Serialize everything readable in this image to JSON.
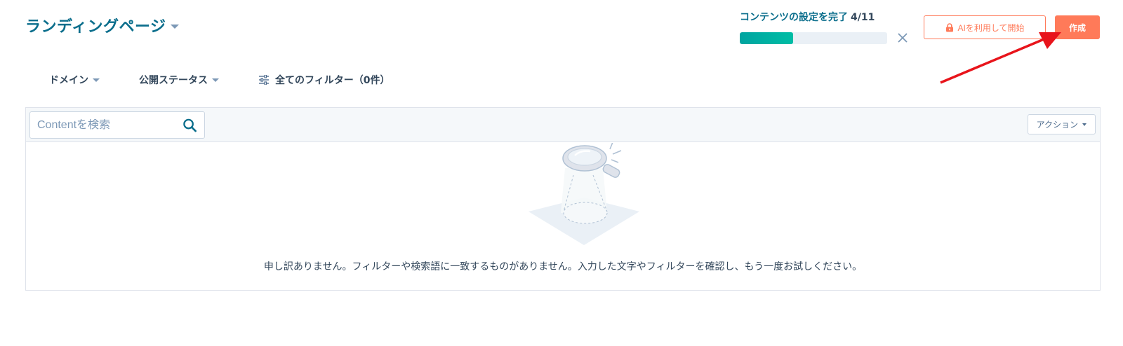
{
  "header": {
    "title": "ランディングページ"
  },
  "progress": {
    "label": "コンテンツの設定を完了",
    "count": "4/11",
    "fraction": 0.36
  },
  "buttons": {
    "ai_label": "AIを利用して開始",
    "create_label": "作成",
    "actions_label": "アクション"
  },
  "filters": {
    "domain": "ドメイン",
    "status": "公開ステータス",
    "all_filters": "全てのフィルター（0件）"
  },
  "search": {
    "placeholder": "Contentを検索"
  },
  "empty_state": {
    "message": "申し訳ありません。フィルターや検索語に一致するものがありません。入力した文字やフィルターを確認し、もう一度お試しください。"
  },
  "colors": {
    "brand_title": "#0b6e8c",
    "accent_orange": "#ff7a59",
    "progress_fill": "#00a4a0",
    "annotation_arrow": "#e8141b"
  }
}
